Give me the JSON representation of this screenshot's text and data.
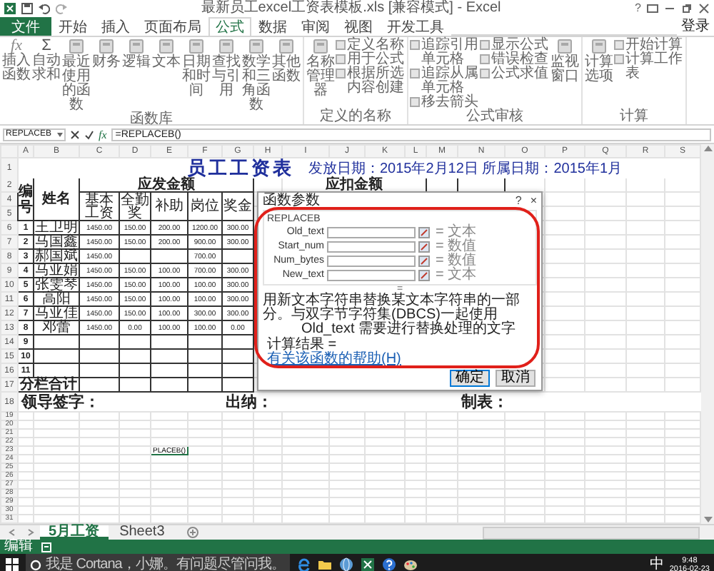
{
  "window": {
    "title": "最新员工excel工资表模板.xls  [兼容模式] - Excel",
    "help": "?"
  },
  "ribbon_tabs": [
    {
      "label": "文件",
      "kind": "file",
      "selected": false
    },
    {
      "label": "开始",
      "kind": "tab",
      "selected": false
    },
    {
      "label": "插入",
      "kind": "tab",
      "selected": false
    },
    {
      "label": "页面布局",
      "kind": "tab",
      "selected": false
    },
    {
      "label": "公式",
      "kind": "tab",
      "selected": true
    },
    {
      "label": "数据",
      "kind": "tab",
      "selected": false
    },
    {
      "label": "审阅",
      "kind": "tab",
      "selected": false
    },
    {
      "label": "视图",
      "kind": "tab",
      "selected": false
    },
    {
      "label": "开发工具",
      "kind": "tab",
      "selected": false
    }
  ],
  "account": "登录",
  "ribbon_groups": [
    {
      "label": "函数库",
      "items": [
        {
          "kind": "large",
          "label": "插入函数",
          "glyph": "fx"
        },
        {
          "kind": "large",
          "label": "自动求和",
          "glyph": "Σ"
        },
        {
          "kind": "large",
          "label": "最近使用的函数"
        },
        {
          "kind": "large",
          "label": "财务"
        },
        {
          "kind": "large",
          "label": "逻辑"
        },
        {
          "kind": "large",
          "label": "文本"
        },
        {
          "kind": "large",
          "label": "日期和时间"
        },
        {
          "kind": "large",
          "label": "查找与引用"
        },
        {
          "kind": "large",
          "label": "数学和三角函数"
        },
        {
          "kind": "large",
          "label": "其他函数"
        }
      ]
    },
    {
      "label": "定义的名称",
      "items": [
        {
          "kind": "large",
          "label": "名称管理器"
        },
        {
          "kind": "stack",
          "entries": [
            "定义名称",
            "用于公式",
            "根据所选内容创建"
          ]
        }
      ]
    },
    {
      "label": "公式审核",
      "items": [
        {
          "kind": "stack",
          "entries": [
            "追踪引用单元格",
            "追踪从属单元格",
            "移去箭头"
          ]
        },
        {
          "kind": "stack",
          "entries": [
            "显示公式",
            "错误检查",
            "公式求值"
          ]
        },
        {
          "kind": "large",
          "label": "监视窗口"
        }
      ]
    },
    {
      "label": "计算",
      "items": [
        {
          "kind": "large",
          "label": "计算选项"
        },
        {
          "kind": "stack",
          "entries": [
            "开始计算",
            "计算工作表"
          ]
        }
      ]
    }
  ],
  "formula_bar": {
    "name_box": "REPLACEB",
    "fx": "fx",
    "formula": "=REPLACEB()"
  },
  "column_headers": [
    "A",
    "B",
    "C",
    "D",
    "E",
    "F",
    "G",
    "H",
    "I",
    "J",
    "K",
    "L",
    "M",
    "N",
    "O",
    "P",
    "Q",
    "R",
    "S"
  ],
  "row_headers": [
    "1",
    "2",
    "4",
    "5",
    "6",
    "7",
    "8",
    "9",
    "10",
    "11",
    "12",
    "13",
    "14",
    "15",
    "16",
    "17",
    "18",
    "19",
    "20",
    "21",
    "22",
    "23",
    "24",
    "25",
    "26",
    "27",
    "28",
    "29",
    "30",
    "31"
  ],
  "sheet": {
    "title": "员工工资表",
    "date_note": "发放日期：2015年2月12日   所属日期：2015年1月",
    "header": {
      "id": "编号",
      "name": "姓名",
      "income_group": "应发金额",
      "deduction_group": "应扣金额",
      "income_columns": [
        "基本工资",
        "全勤奖",
        "补助",
        "岗位",
        "奖金"
      ]
    },
    "employees": [
      {
        "no": "1",
        "name": "王卫明",
        "amounts": {
          "basic": "1450.00",
          "attendance": "150.00",
          "subsidy": "200.00",
          "post": "1200.00",
          "bonus": "300.00"
        }
      },
      {
        "no": "2",
        "name": "马国鑫",
        "amounts": {
          "basic": "1450.00",
          "attendance": "150.00",
          "subsidy": "200.00",
          "post": "900.00",
          "bonus": "300.00"
        }
      },
      {
        "no": "3",
        "name": "郝国斌",
        "amounts": {
          "basic": "1450.00",
          "post": "700.00"
        }
      },
      {
        "no": "4",
        "name": "马亚娟",
        "amounts": {
          "basic": "1450.00",
          "attendance": "150.00",
          "subsidy": "100.00",
          "post": "700.00",
          "bonus": "300.00"
        }
      },
      {
        "no": "5",
        "name": "张雯琴",
        "amounts": {
          "basic": "1450.00",
          "attendance": "150.00",
          "subsidy": "100.00",
          "post": "100.00",
          "bonus": "300.00"
        }
      },
      {
        "no": "6",
        "name": "高阳",
        "amounts": {
          "basic": "1450.00",
          "attendance": "150.00",
          "subsidy": "100.00",
          "post": "100.00",
          "bonus": "300.00"
        }
      },
      {
        "no": "7",
        "name": "马亚佳",
        "amounts": {
          "basic": "1450.00",
          "attendance": "150.00",
          "subsidy": "100.00",
          "post": "300.00",
          "bonus": "300.00"
        }
      },
      {
        "no": "8",
        "name": "邓蕾",
        "amounts": {
          "basic": "1450.00",
          "attendance": "0.00",
          "subsidy": "100.00",
          "post": "100.00",
          "bonus": "0.00"
        }
      }
    ],
    "blank_numbers": [
      "9",
      "10",
      "11"
    ],
    "subtotal_label": "分栏合计",
    "signatures": [
      "领导签字：",
      "出纳：",
      "制表："
    ],
    "editing_cell": "PLACEB()"
  },
  "dialog": {
    "title": "函数参数",
    "help": "?",
    "close": "×",
    "function": "REPLACEB",
    "arguments": [
      {
        "name": "Old_text",
        "result": "= 文本"
      },
      {
        "name": "Start_num",
        "result": "= 数值"
      },
      {
        "name": "Num_bytes",
        "result": "= 数值"
      },
      {
        "name": "New_text",
        "result": "= 文本"
      }
    ],
    "overall_result": "=",
    "description": "用新文本字符串替换某文本字符串的一部分。与双字节字符集(DBCS)一起使用",
    "argument_help": "Old_text  需要进行替换处理的文字",
    "computed": "计算结果 =",
    "help_link": "有关该函数的帮助(H)",
    "buttons": [
      "确定",
      "取消"
    ]
  },
  "sheet_tabs": [
    {
      "label": "5月工资",
      "selected": true
    },
    {
      "label": "Sheet3",
      "selected": false
    }
  ],
  "status_bar": {
    "mode": "编辑"
  },
  "taskbar": {
    "search_placeholder": "我是 Cortana，小娜。有问题尽管问我。",
    "ime": "中",
    "time": "9:48",
    "date": "2016-02-23"
  }
}
